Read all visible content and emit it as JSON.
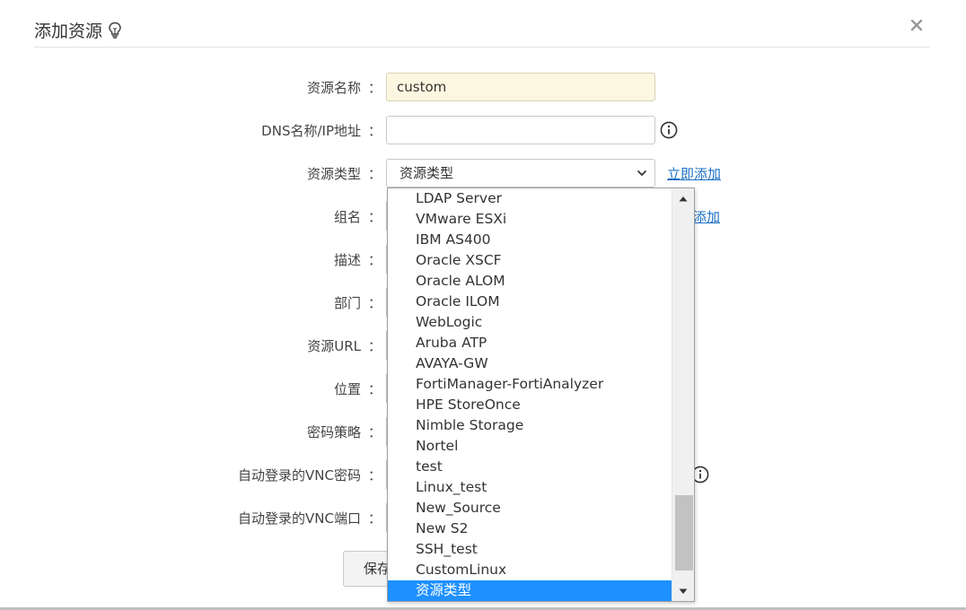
{
  "dialog": {
    "title": "添加资源",
    "close_label": "×"
  },
  "form": {
    "colon": "：",
    "resource_name_label": "资源名称",
    "resource_name_value": "custom",
    "dns_label": "DNS名称/IP地址",
    "dns_value": "",
    "resource_type_label": "资源类型",
    "resource_type_value": "资源类型",
    "add_now_link": "立即添加",
    "group_label": "组名",
    "group_add_link_partial": "添加",
    "description_label": "描述",
    "department_label": "部门",
    "resource_url_label": "资源URL",
    "location_label": "位置",
    "password_policy_label": "密码策略",
    "vnc_password_label": "自动登录的VNC密码",
    "vnc_port_label": "自动登录的VNC端口",
    "save_label": "保存"
  },
  "dropdown": {
    "options": [
      "LDAP Server",
      "VMware ESXi",
      "IBM AS400",
      "Oracle XSCF",
      "Oracle ALOM",
      "Oracle ILOM",
      "WebLogic",
      "Aruba ATP",
      "AVAYA-GW",
      "FortiManager-FortiAnalyzer",
      "HPE StoreOnce",
      "Nimble Storage",
      "Nortel",
      "test",
      "Linux_test",
      "New_Source",
      "New S2",
      "SSH_test",
      "CustomLinux",
      "资源类型"
    ],
    "selected": "资源类型"
  },
  "colors": {
    "accent": "#1e90ff",
    "link": "#1a6fc4",
    "filled_input": "#fcf7e0"
  }
}
